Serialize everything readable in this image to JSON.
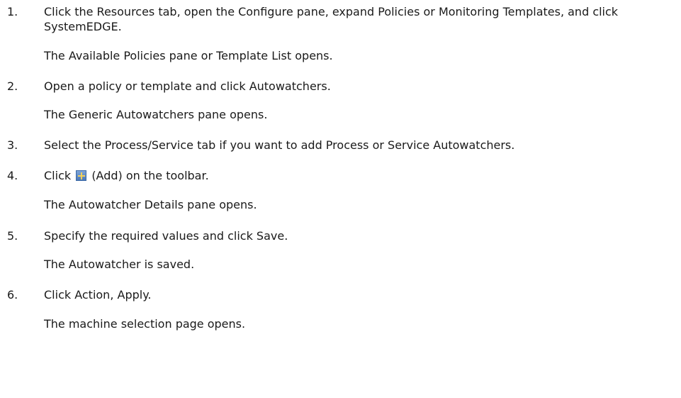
{
  "steps": [
    {
      "number": "1.",
      "text": "Click the Resources tab, open the Configure pane, expand Policies or Monitoring Templates, and click SystemEDGE.",
      "result": "The Available Policies pane or Template List opens."
    },
    {
      "number": "2.",
      "text": "Open a policy or template and click Autowatchers.",
      "result": "The Generic Autowatchers pane opens."
    },
    {
      "number": "3.",
      "text": "Select the Process/Service tab if you want to add Process or Service Autowatchers."
    },
    {
      "number": "4.",
      "text_before": "Click",
      "icon": "add-icon",
      "text_after": "(Add) on the toolbar.",
      "result": "The Autowatcher Details pane opens."
    },
    {
      "number": "5.",
      "text": "Specify the required values and click Save.",
      "result": "The Autowatcher is saved."
    },
    {
      "number": "6.",
      "text": "Click Action, Apply.",
      "result": "The machine selection page opens."
    }
  ]
}
